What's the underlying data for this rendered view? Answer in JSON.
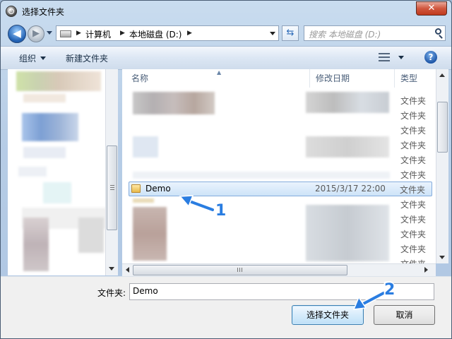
{
  "window": {
    "title": "选择文件夹",
    "close_label": "✕"
  },
  "nav": {
    "back_glyph": "◀",
    "forward_glyph": "▶",
    "breadcrumbs": [
      "计算机",
      "本地磁盘 (D:)"
    ],
    "refresh_glyph": "⇆",
    "search_placeholder": "搜索 本地磁盘 (D:)"
  },
  "toolbar": {
    "organize_label": "组织",
    "new_folder_label": "新建文件夹",
    "help_label": "?"
  },
  "file_list": {
    "columns": {
      "name": "名称",
      "date": "修改日期",
      "type": "类型"
    },
    "type_cells": [
      "文件夹",
      "文件夹",
      "文件夹",
      "文件夹",
      "文件夹",
      "文件夹",
      "文件夹",
      "文件夹",
      "文件夹",
      "文件夹",
      "文件夹",
      "文件夹"
    ],
    "selected": {
      "name": "Demo",
      "date": "2015/3/17 22:00",
      "type": "文件夹"
    }
  },
  "footer": {
    "folder_label": "文件夹:",
    "folder_value": "Demo",
    "select_button": "选择文件夹",
    "cancel_button": "取消"
  },
  "annotations": {
    "step1": "1",
    "step2": "2",
    "color": "#2a7de1"
  },
  "icons": [
    "app-icon",
    "back-arrow-icon",
    "forward-arrow-icon",
    "drive-icon",
    "refresh-icon",
    "search-icon",
    "view-icon",
    "help-icon",
    "folder-icon"
  ]
}
